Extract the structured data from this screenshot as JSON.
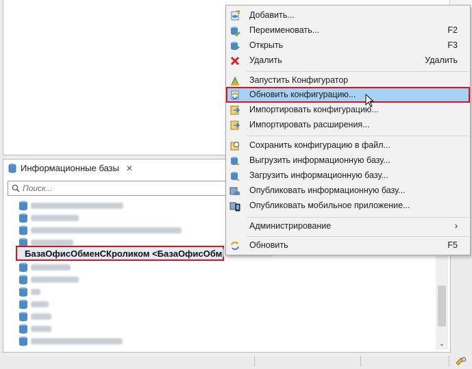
{
  "panel": {
    "title": "Информационные базы",
    "search_placeholder": "Поиск..."
  },
  "tree": {
    "selected_label": "БазаОфисОбменСКроликом <БазаОфисОбменС"
  },
  "menu": {
    "items": [
      {
        "label": "Добавить...",
        "shortcut": "",
        "icon": "add-icon"
      },
      {
        "label": "Переименовать...",
        "shortcut": "F2",
        "icon": "rename-icon"
      },
      {
        "label": "Открыть",
        "shortcut": "F3",
        "icon": "open-icon"
      },
      {
        "label": "Удалить",
        "shortcut": "Удалить",
        "icon": "delete-icon"
      },
      {
        "label": "Запустить Конфигуратор",
        "shortcut": "",
        "icon": "configurator-icon"
      },
      {
        "label": "Обновить конфигурацию...",
        "shortcut": "",
        "icon": "update-config-icon"
      },
      {
        "label": "Импортировать конфигурацию...",
        "shortcut": "",
        "icon": "import-config-icon"
      },
      {
        "label": "Импортировать расширения...",
        "shortcut": "",
        "icon": "import-extensions-icon"
      },
      {
        "label": "Сохранить конфигурацию в файл...",
        "shortcut": "",
        "icon": "save-config-icon"
      },
      {
        "label": "Выгрузить информационную базу...",
        "shortcut": "",
        "icon": "export-db-icon"
      },
      {
        "label": "Загрузить информационную базу...",
        "shortcut": "",
        "icon": "load-db-icon"
      },
      {
        "label": "Опубликовать информационную базу...",
        "shortcut": "",
        "icon": "publish-db-icon"
      },
      {
        "label": "Опубликовать мобильное приложение...",
        "shortcut": "",
        "icon": "publish-mobile-icon"
      },
      {
        "label": "Администрирование",
        "shortcut": "›",
        "icon": ""
      },
      {
        "label": "Обновить",
        "shortcut": "F5",
        "icon": "refresh-icon"
      }
    ]
  },
  "colors": {
    "highlight": "#a6d2f6",
    "annotation_red": "#d7141a",
    "selection_bg": "#e3eaf3"
  }
}
